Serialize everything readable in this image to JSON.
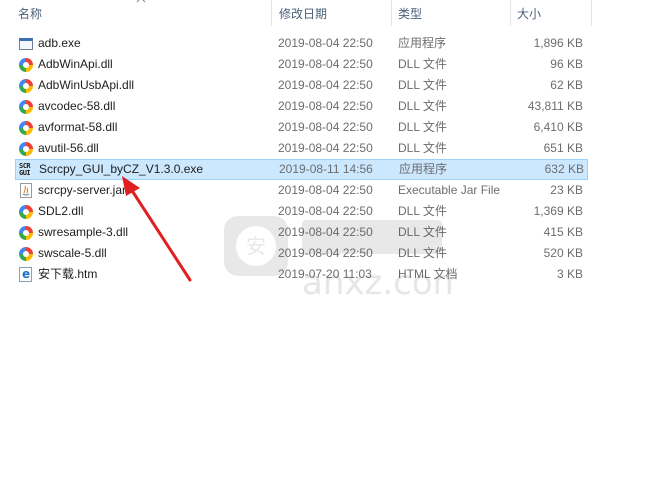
{
  "columns": {
    "name": "名称",
    "date": "修改日期",
    "type": "类型",
    "size": "大小"
  },
  "files": [
    {
      "name": "adb.exe",
      "date": "2019-08-04 22:50",
      "type": "应用程序",
      "size": "1,896 KB",
      "icon": "exe-icon"
    },
    {
      "name": "AdbWinApi.dll",
      "date": "2019-08-04 22:50",
      "type": "DLL 文件",
      "size": "96 KB",
      "icon": "dll-icon"
    },
    {
      "name": "AdbWinUsbApi.dll",
      "date": "2019-08-04 22:50",
      "type": "DLL 文件",
      "size": "62 KB",
      "icon": "dll-icon"
    },
    {
      "name": "avcodec-58.dll",
      "date": "2019-08-04 22:50",
      "type": "DLL 文件",
      "size": "43,811 KB",
      "icon": "dll-icon"
    },
    {
      "name": "avformat-58.dll",
      "date": "2019-08-04 22:50",
      "type": "DLL 文件",
      "size": "6,410 KB",
      "icon": "dll-icon"
    },
    {
      "name": "avutil-56.dll",
      "date": "2019-08-04 22:50",
      "type": "DLL 文件",
      "size": "651 KB",
      "icon": "dll-icon"
    },
    {
      "name": "Scrcpy_GUI_byCZ_V1.3.0.exe",
      "date": "2019-08-11 14:56",
      "type": "应用程序",
      "size": "632 KB",
      "icon": "scrcpy-icon",
      "selected": true,
      "icon_text": "SCR\nGUI"
    },
    {
      "name": "scrcpy-server.jar",
      "date": "2019-08-04 22:50",
      "type": "Executable Jar File",
      "size": "23 KB",
      "icon": "jar-icon"
    },
    {
      "name": "SDL2.dll",
      "date": "2019-08-04 22:50",
      "type": "DLL 文件",
      "size": "1,369 KB",
      "icon": "dll-icon"
    },
    {
      "name": "swresample-3.dll",
      "date": "2019-08-04 22:50",
      "type": "DLL 文件",
      "size": "415 KB",
      "icon": "dll-icon"
    },
    {
      "name": "swscale-5.dll",
      "date": "2019-08-04 22:50",
      "type": "DLL 文件",
      "size": "520 KB",
      "icon": "dll-icon"
    },
    {
      "name": "安下载.htm",
      "date": "2019-07-20 11:03",
      "type": "HTML 文档",
      "size": "3 KB",
      "icon": "htm-icon"
    }
  ],
  "watermark": {
    "text": "anxz.com",
    "badge_text": "安"
  },
  "colors": {
    "selection_bg": "#cce8ff",
    "selection_border": "#99d1ff",
    "annotation_arrow": "#e02020",
    "header_text": "#4c607a"
  }
}
